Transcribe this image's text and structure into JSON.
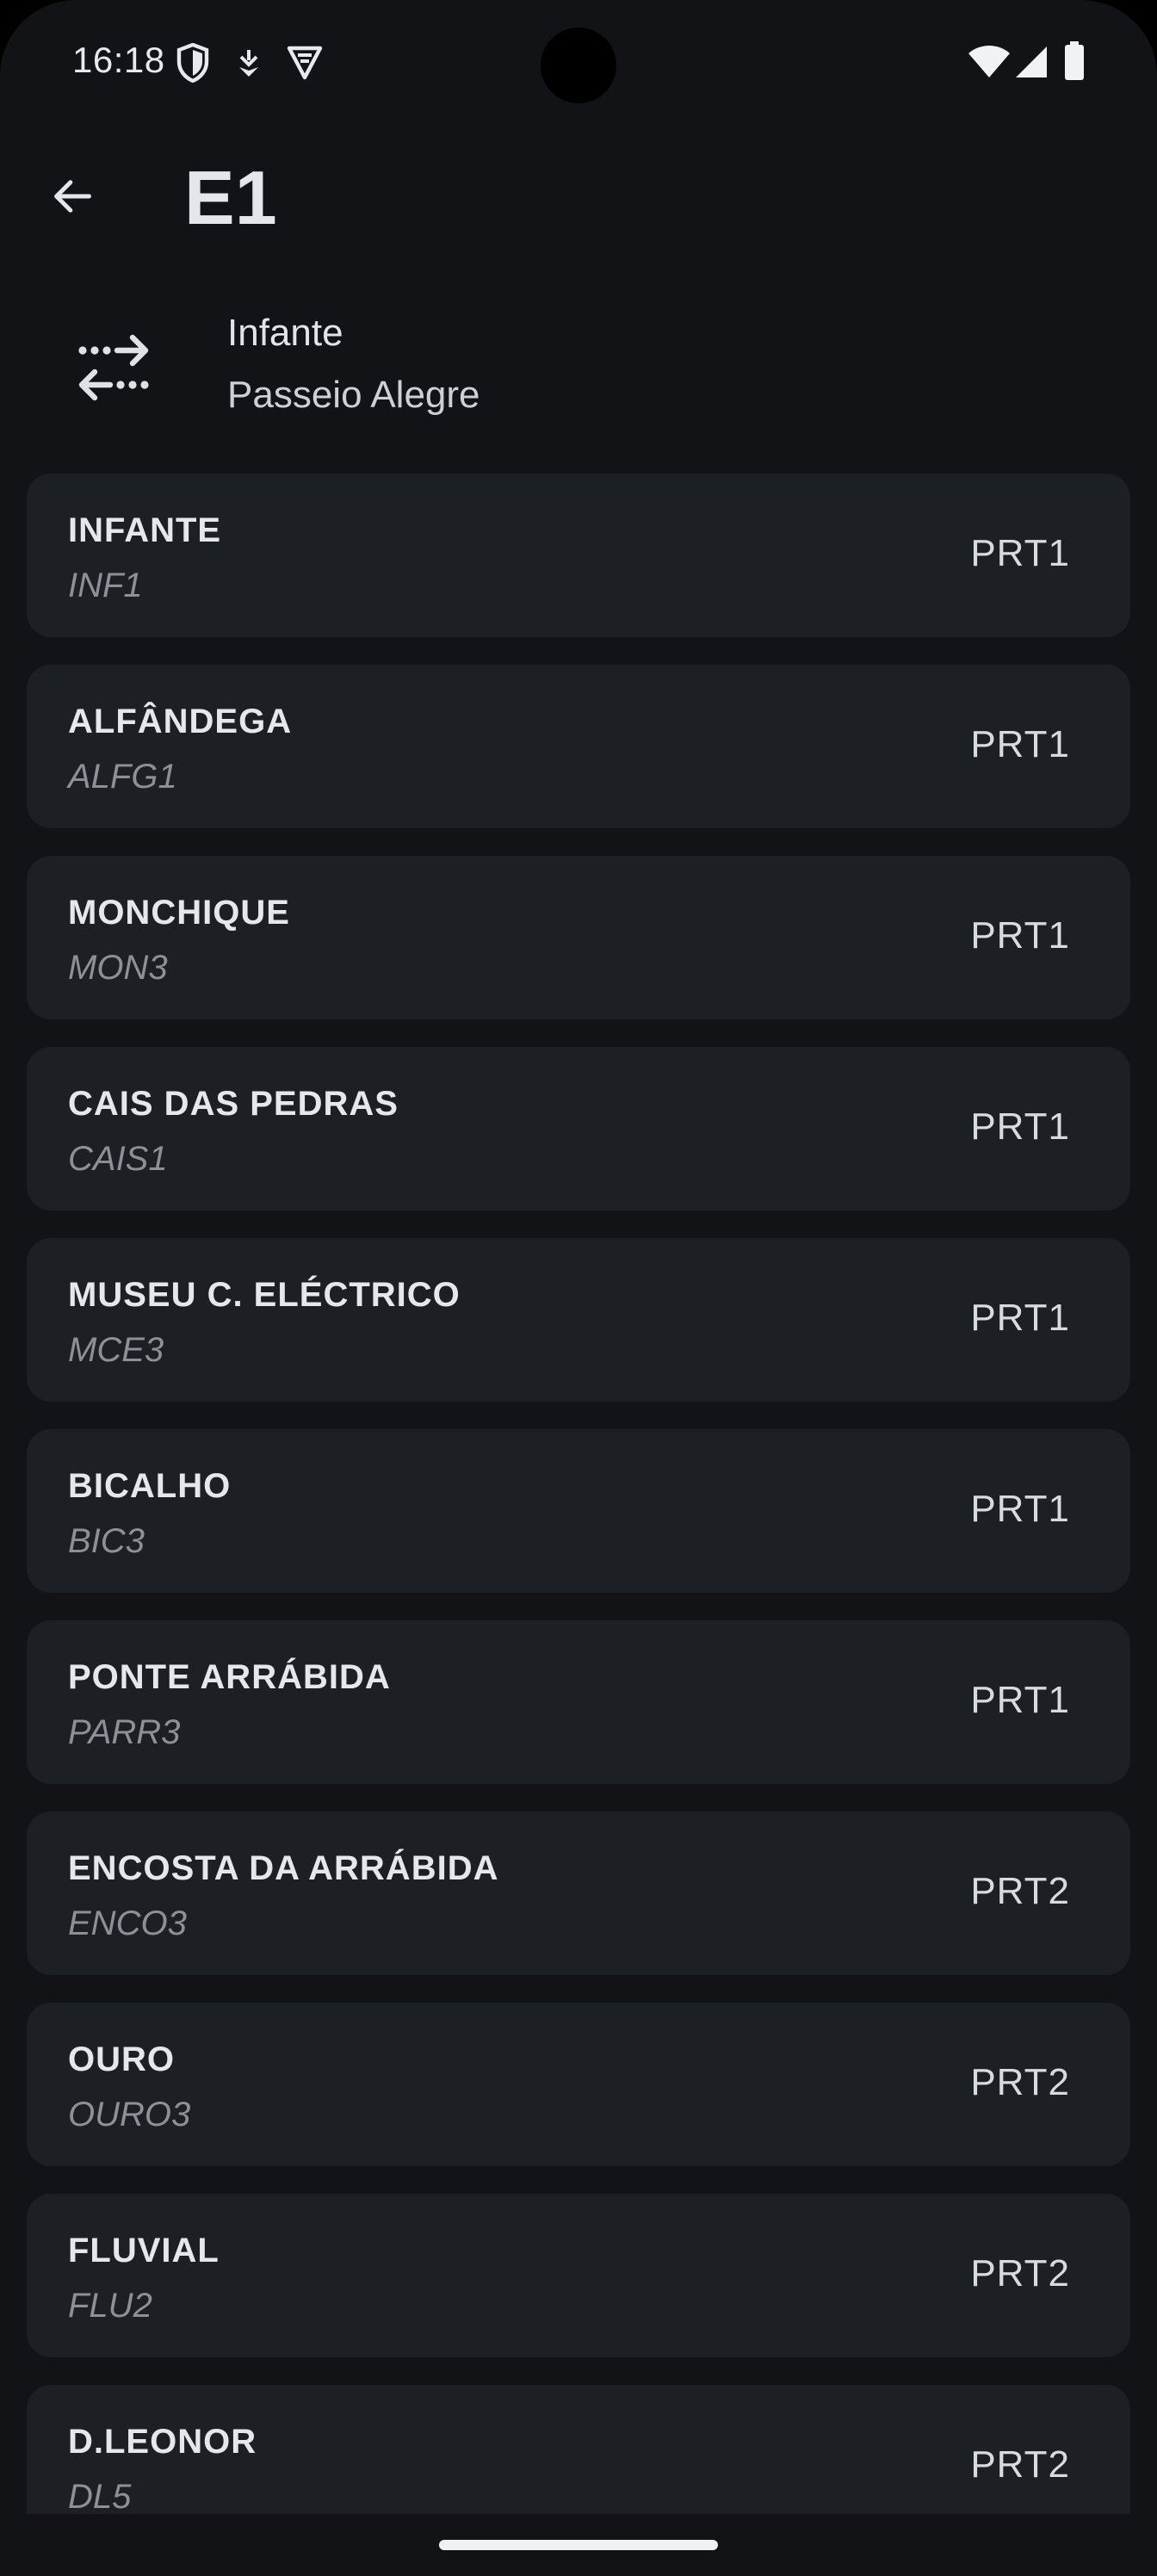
{
  "status_bar": {
    "time": "16:18",
    "left_icons": [
      "shield-icon",
      "download-badge-icon",
      "vpn-icon"
    ],
    "right_icons": [
      "wifi-icon",
      "signal-icon",
      "battery-icon"
    ]
  },
  "header": {
    "title": "E1",
    "back_icon": "arrow-back-icon"
  },
  "direction": {
    "icon": "swap-direction-icon",
    "from": "Infante",
    "to": "Passeio Alegre"
  },
  "stops": [
    {
      "name": "INFANTE",
      "code": "INF1",
      "zone": "PRT1"
    },
    {
      "name": "ALFÂNDEGA",
      "code": "ALFG1",
      "zone": "PRT1"
    },
    {
      "name": "MONCHIQUE",
      "code": "MON3",
      "zone": "PRT1"
    },
    {
      "name": "CAIS DAS PEDRAS",
      "code": "CAIS1",
      "zone": "PRT1"
    },
    {
      "name": "MUSEU C. ELÉCTRICO",
      "code": "MCE3",
      "zone": "PRT1"
    },
    {
      "name": "BICALHO",
      "code": "BIC3",
      "zone": "PRT1"
    },
    {
      "name": "PONTE ARRÁBIDA",
      "code": "PARR3",
      "zone": "PRT1"
    },
    {
      "name": "ENCOSTA DA ARRÁBIDA",
      "code": "ENCO3",
      "zone": "PRT2"
    },
    {
      "name": "OURO",
      "code": "OURO3",
      "zone": "PRT2"
    },
    {
      "name": "FLUVIAL",
      "code": "FLU2",
      "zone": "PRT2"
    },
    {
      "name": "D.LEONOR",
      "code": "DL5",
      "zone": "PRT2"
    }
  ],
  "colors": {
    "background": "#111317",
    "card": "#1c1f24",
    "text_primary": "#e6e7ec",
    "text_secondary": "#8d9097"
  }
}
